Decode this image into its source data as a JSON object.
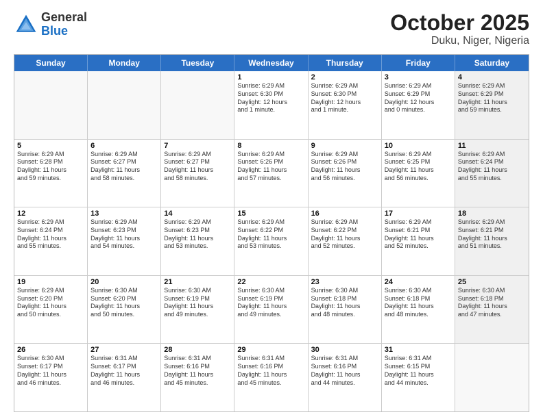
{
  "logo": {
    "general": "General",
    "blue": "Blue"
  },
  "title": "October 2025",
  "subtitle": "Duku, Niger, Nigeria",
  "header_days": [
    "Sunday",
    "Monday",
    "Tuesday",
    "Wednesday",
    "Thursday",
    "Friday",
    "Saturday"
  ],
  "weeks": [
    [
      {
        "day": "",
        "text": "",
        "empty": true
      },
      {
        "day": "",
        "text": "",
        "empty": true
      },
      {
        "day": "",
        "text": "",
        "empty": true
      },
      {
        "day": "1",
        "text": "Sunrise: 6:29 AM\nSunset: 6:30 PM\nDaylight: 12 hours\nand 1 minute."
      },
      {
        "day": "2",
        "text": "Sunrise: 6:29 AM\nSunset: 6:30 PM\nDaylight: 12 hours\nand 1 minute."
      },
      {
        "day": "3",
        "text": "Sunrise: 6:29 AM\nSunset: 6:29 PM\nDaylight: 12 hours\nand 0 minutes."
      },
      {
        "day": "4",
        "text": "Sunrise: 6:29 AM\nSunset: 6:29 PM\nDaylight: 11 hours\nand 59 minutes.",
        "shade": true
      }
    ],
    [
      {
        "day": "5",
        "text": "Sunrise: 6:29 AM\nSunset: 6:28 PM\nDaylight: 11 hours\nand 59 minutes."
      },
      {
        "day": "6",
        "text": "Sunrise: 6:29 AM\nSunset: 6:27 PM\nDaylight: 11 hours\nand 58 minutes."
      },
      {
        "day": "7",
        "text": "Sunrise: 6:29 AM\nSunset: 6:27 PM\nDaylight: 11 hours\nand 58 minutes."
      },
      {
        "day": "8",
        "text": "Sunrise: 6:29 AM\nSunset: 6:26 PM\nDaylight: 11 hours\nand 57 minutes."
      },
      {
        "day": "9",
        "text": "Sunrise: 6:29 AM\nSunset: 6:26 PM\nDaylight: 11 hours\nand 56 minutes."
      },
      {
        "day": "10",
        "text": "Sunrise: 6:29 AM\nSunset: 6:25 PM\nDaylight: 11 hours\nand 56 minutes."
      },
      {
        "day": "11",
        "text": "Sunrise: 6:29 AM\nSunset: 6:24 PM\nDaylight: 11 hours\nand 55 minutes.",
        "shade": true
      }
    ],
    [
      {
        "day": "12",
        "text": "Sunrise: 6:29 AM\nSunset: 6:24 PM\nDaylight: 11 hours\nand 55 minutes."
      },
      {
        "day": "13",
        "text": "Sunrise: 6:29 AM\nSunset: 6:23 PM\nDaylight: 11 hours\nand 54 minutes."
      },
      {
        "day": "14",
        "text": "Sunrise: 6:29 AM\nSunset: 6:23 PM\nDaylight: 11 hours\nand 53 minutes."
      },
      {
        "day": "15",
        "text": "Sunrise: 6:29 AM\nSunset: 6:22 PM\nDaylight: 11 hours\nand 53 minutes."
      },
      {
        "day": "16",
        "text": "Sunrise: 6:29 AM\nSunset: 6:22 PM\nDaylight: 11 hours\nand 52 minutes."
      },
      {
        "day": "17",
        "text": "Sunrise: 6:29 AM\nSunset: 6:21 PM\nDaylight: 11 hours\nand 52 minutes."
      },
      {
        "day": "18",
        "text": "Sunrise: 6:29 AM\nSunset: 6:21 PM\nDaylight: 11 hours\nand 51 minutes.",
        "shade": true
      }
    ],
    [
      {
        "day": "19",
        "text": "Sunrise: 6:29 AM\nSunset: 6:20 PM\nDaylight: 11 hours\nand 50 minutes."
      },
      {
        "day": "20",
        "text": "Sunrise: 6:30 AM\nSunset: 6:20 PM\nDaylight: 11 hours\nand 50 minutes."
      },
      {
        "day": "21",
        "text": "Sunrise: 6:30 AM\nSunset: 6:19 PM\nDaylight: 11 hours\nand 49 minutes."
      },
      {
        "day": "22",
        "text": "Sunrise: 6:30 AM\nSunset: 6:19 PM\nDaylight: 11 hours\nand 49 minutes."
      },
      {
        "day": "23",
        "text": "Sunrise: 6:30 AM\nSunset: 6:18 PM\nDaylight: 11 hours\nand 48 minutes."
      },
      {
        "day": "24",
        "text": "Sunrise: 6:30 AM\nSunset: 6:18 PM\nDaylight: 11 hours\nand 48 minutes."
      },
      {
        "day": "25",
        "text": "Sunrise: 6:30 AM\nSunset: 6:18 PM\nDaylight: 11 hours\nand 47 minutes.",
        "shade": true
      }
    ],
    [
      {
        "day": "26",
        "text": "Sunrise: 6:30 AM\nSunset: 6:17 PM\nDaylight: 11 hours\nand 46 minutes."
      },
      {
        "day": "27",
        "text": "Sunrise: 6:31 AM\nSunset: 6:17 PM\nDaylight: 11 hours\nand 46 minutes."
      },
      {
        "day": "28",
        "text": "Sunrise: 6:31 AM\nSunset: 6:16 PM\nDaylight: 11 hours\nand 45 minutes."
      },
      {
        "day": "29",
        "text": "Sunrise: 6:31 AM\nSunset: 6:16 PM\nDaylight: 11 hours\nand 45 minutes."
      },
      {
        "day": "30",
        "text": "Sunrise: 6:31 AM\nSunset: 6:16 PM\nDaylight: 11 hours\nand 44 minutes."
      },
      {
        "day": "31",
        "text": "Sunrise: 6:31 AM\nSunset: 6:15 PM\nDaylight: 11 hours\nand 44 minutes."
      },
      {
        "day": "",
        "text": "",
        "empty": true,
        "shade": true
      }
    ]
  ]
}
